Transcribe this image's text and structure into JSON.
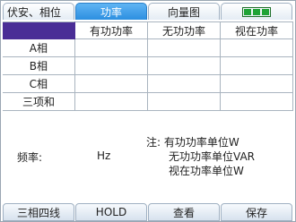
{
  "tabs": {
    "mode": "伏安、相位",
    "active": "功率",
    "vector": "向量图",
    "battery_level": "full"
  },
  "table": {
    "headers": [
      "",
      "有功功率",
      "无功功率",
      "视在功率"
    ],
    "rows": [
      {
        "label": "A相",
        "values": [
          "",
          "",
          ""
        ]
      },
      {
        "label": "B相",
        "values": [
          "",
          "",
          ""
        ]
      },
      {
        "label": "C相",
        "values": [
          "",
          "",
          ""
        ]
      },
      {
        "label": "三项和",
        "values": [
          "",
          "",
          ""
        ]
      }
    ]
  },
  "frequency": {
    "label": "频率:",
    "unit": "Hz"
  },
  "note": {
    "line1": "注: 有功功率单位W",
    "line2": "无功功率单位VAR",
    "line3": "视在功率单位W"
  },
  "softkeys": [
    "三相四线",
    "HOLD",
    "查看",
    "保存"
  ],
  "colors": {
    "active_tab": "#2c8fe0",
    "header_corner": "#4a2d96",
    "battery": "#1fa336"
  }
}
